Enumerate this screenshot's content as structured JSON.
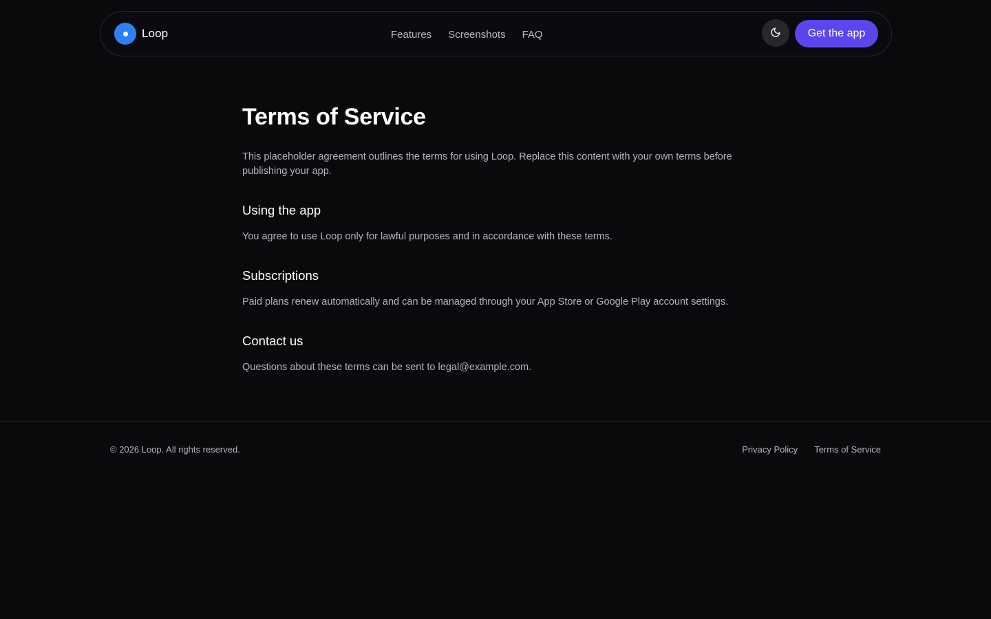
{
  "header": {
    "brand": {
      "name": "Loop",
      "icon": "loop-logo-icon",
      "color": "#2f7ff7"
    },
    "nav_links": [
      {
        "label": "Features"
      },
      {
        "label": "Screenshots"
      },
      {
        "label": "FAQ"
      }
    ],
    "theme_toggle": {
      "icon": "moon-icon"
    },
    "cta_label": "Get the app",
    "cta_color": "#5b46ee"
  },
  "main": {
    "title": "Terms of Service",
    "intro": "This placeholder agreement outlines the terms for using Loop. Replace this content with your own terms before publishing your app.",
    "sections": [
      {
        "heading": "Using the app",
        "body": "You agree to use Loop only for lawful purposes and in accordance with these terms."
      },
      {
        "heading": "Subscriptions",
        "body": "Paid plans renew automatically and can be managed through your App Store or Google Play account settings."
      },
      {
        "heading": "Contact us",
        "body": "Questions about these terms can be sent to legal@example.com."
      }
    ]
  },
  "footer": {
    "copyright": "© 2026 Loop. All rights reserved.",
    "links": [
      {
        "label": "Privacy Policy"
      },
      {
        "label": "Terms of Service"
      }
    ]
  },
  "colors": {
    "background": "#0a0a0d",
    "text_muted": "#b4b4bd"
  }
}
